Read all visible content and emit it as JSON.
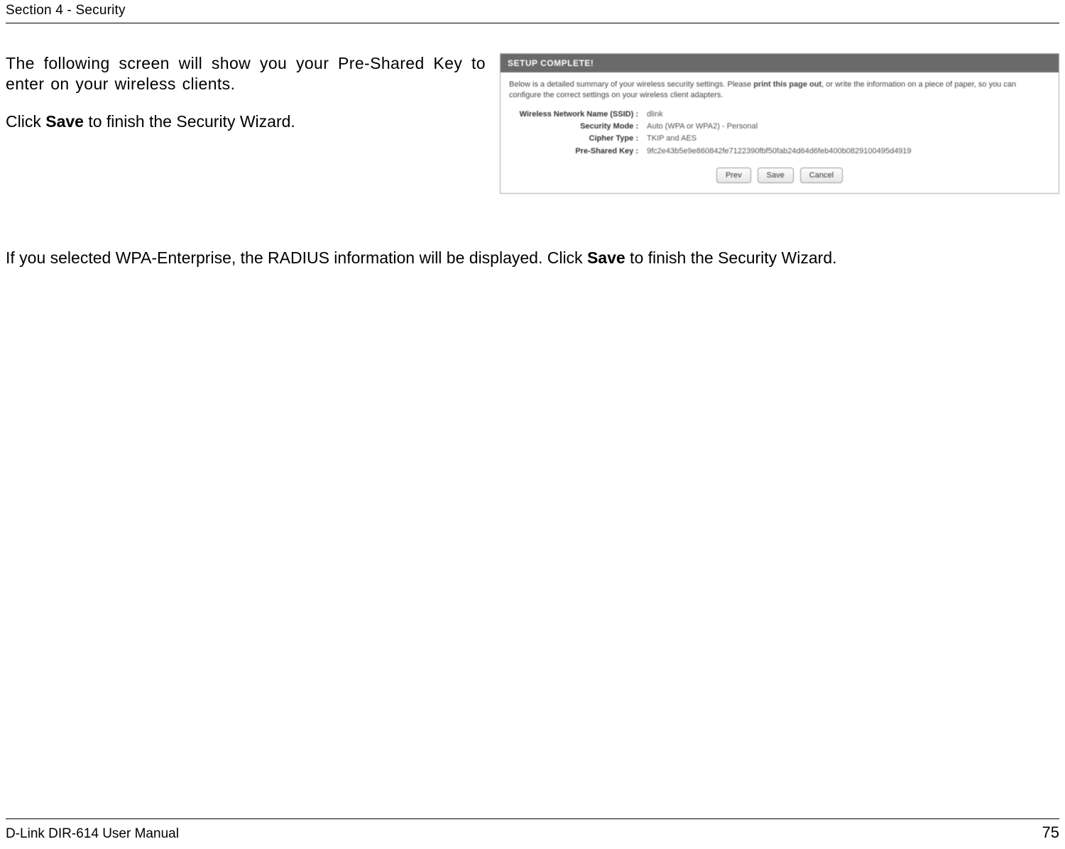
{
  "header": {
    "section": "Section 4 - Security"
  },
  "body": {
    "p1": "The following screen will show you your Pre-Shared Key to enter on your wireless clients.",
    "p2_prefix": "Click ",
    "p2_bold": "Save",
    "p2_suffix": " to finish the Security Wizard.",
    "p3_prefix": "If you selected WPA-Enterprise, the RADIUS information will be displayed. Click ",
    "p3_bold": "Save",
    "p3_suffix": " to finish the Security Wizard."
  },
  "panel": {
    "title": "SETUP COMPLETE!",
    "desc_prefix": "Below is a detailed summary of your wireless security settings. Please ",
    "desc_bold": "print this page out",
    "desc_suffix": ", or write the information on a piece of paper, so you can configure the correct settings on your wireless client adapters.",
    "rows": {
      "ssid_label": "Wireless Network Name (SSID) :",
      "ssid_value": "dlink",
      "mode_label": "Security Mode :",
      "mode_value": "Auto (WPA or WPA2) - Personal",
      "cipher_label": "Cipher Type :",
      "cipher_value": "TKIP and AES",
      "psk_label": "Pre-Shared Key :",
      "psk_value": "9fc2e43b5e9e860842fe7122390fbf50fab24d64d6feb400b0829100495d4919"
    },
    "buttons": {
      "prev": "Prev",
      "save": "Save",
      "cancel": "Cancel"
    }
  },
  "footer": {
    "left": "D-Link DIR-614 User Manual",
    "page": "75"
  }
}
